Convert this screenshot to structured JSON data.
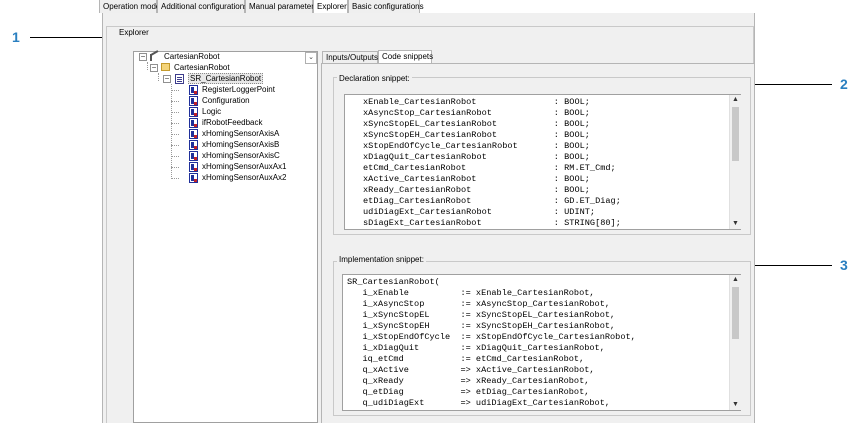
{
  "callouts": [
    "1",
    "2",
    "3"
  ],
  "tabs": [
    "Operation mode",
    "Additional configurations",
    "Manual parameters",
    "Explorer",
    "Basic configurations"
  ],
  "active_tab": "Explorer",
  "explorer_caption": "Explorer",
  "tree": {
    "root": "CartesianRobot",
    "folder": "CartesianRobot",
    "fb": "SR_CartesianRobot",
    "children": [
      "RegisterLoggerPoint",
      "Configuration",
      "Logic",
      "ifRobotFeedback",
      "xHomingSensorAxisA",
      "xHomingSensorAxisB",
      "xHomingSensorAxisC",
      "xHomingSensorAuxAx1",
      "xHomingSensorAuxAx2"
    ],
    "expander_minus": "−",
    "scroll_symbol": "⌄"
  },
  "right_tabs": [
    "Inputs/Outputs",
    "Code snippets"
  ],
  "right_active_tab": "Code snippets",
  "declaration": {
    "caption": "Declaration snippet:",
    "lines": [
      "xEnable_CartesianRobot               : BOOL;",
      "xAsyncStop_CartesianRobot            : BOOL;",
      "xSyncStopEL_CartesianRobot           : BOOL;",
      "xSyncStopEH_CartesianRobot           : BOOL;",
      "xStopEndOfCycle_CartesianRobot       : BOOL;",
      "xDiagQuit_CartesianRobot             : BOOL;",
      "etCmd_CartesianRobot                 : RM.ET_Cmd;",
      "xActive_CartesianRobot               : BOOL;",
      "xReady_CartesianRobot                : BOOL;",
      "etDiag_CartesianRobot                : GD.ET_Diag;",
      "udiDiagExt_CartesianRobot            : UDINT;",
      "sDiagExt_CartesianRobot              : STRING[80];"
    ]
  },
  "implementation": {
    "caption": "Implementation snippet:",
    "lines": [
      "SR_CartesianRobot(",
      "   i_xEnable          := xEnable_CartesianRobot,",
      "   i_xAsyncStop       := xAsyncStop_CartesianRobot,",
      "   i_xSyncStopEL      := xSyncStopEL_CartesianRobot,",
      "   i_xSyncStopEH      := xSyncStopEH_CartesianRobot,",
      "   i_xStopEndOfCycle  := xStopEndOfCycle_CartesianRobot,",
      "   i_xDiagQuit        := xDiagQuit_CartesianRobot,",
      "   iq_etCmd           := etCmd_CartesianRobot,",
      "   q_xActive          => xActive_CartesianRobot,",
      "   q_xReady           => xReady_CartesianRobot,",
      "   q_etDiag           => etDiag_CartesianRobot,",
      "   q_udiDiagExt       => udiDiagExt_CartesianRobot,"
    ]
  },
  "scroll_up": "▲",
  "scroll_down": "▼"
}
